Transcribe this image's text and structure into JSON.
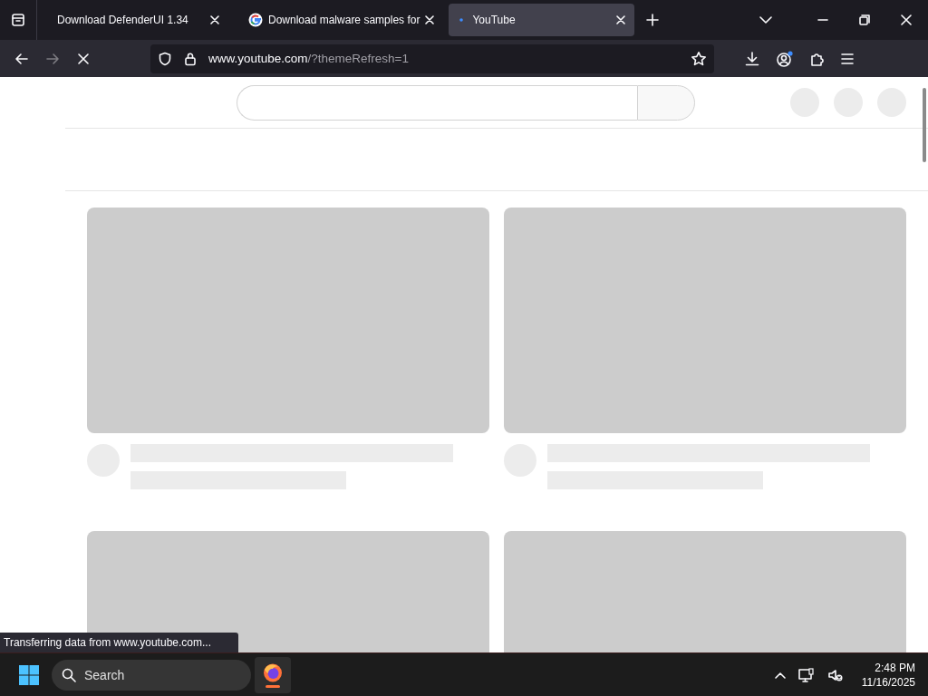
{
  "browser": {
    "tabs": [
      {
        "label": "Download DefenderUI 1.34",
        "selected": false,
        "kind": "plain"
      },
      {
        "label": "Download malware samples for",
        "selected": false,
        "kind": "google"
      },
      {
        "label": "YouTube",
        "selected": true,
        "kind": "loading"
      }
    ],
    "address": {
      "host": "www.youtube.com",
      "path": "/?themeRefresh=1"
    },
    "loading": true,
    "status": "Transferring data from www.youtube.com..."
  },
  "page": {
    "feed": [
      {
        "kind": "skeleton"
      },
      {
        "kind": "skeleton"
      },
      {
        "kind": "thumbnail"
      },
      {
        "kind": "thumbnail"
      }
    ]
  },
  "taskbar": {
    "search": {
      "placeholder": "Search"
    },
    "time": "2:48 PM",
    "date": "11/16/2025"
  }
}
